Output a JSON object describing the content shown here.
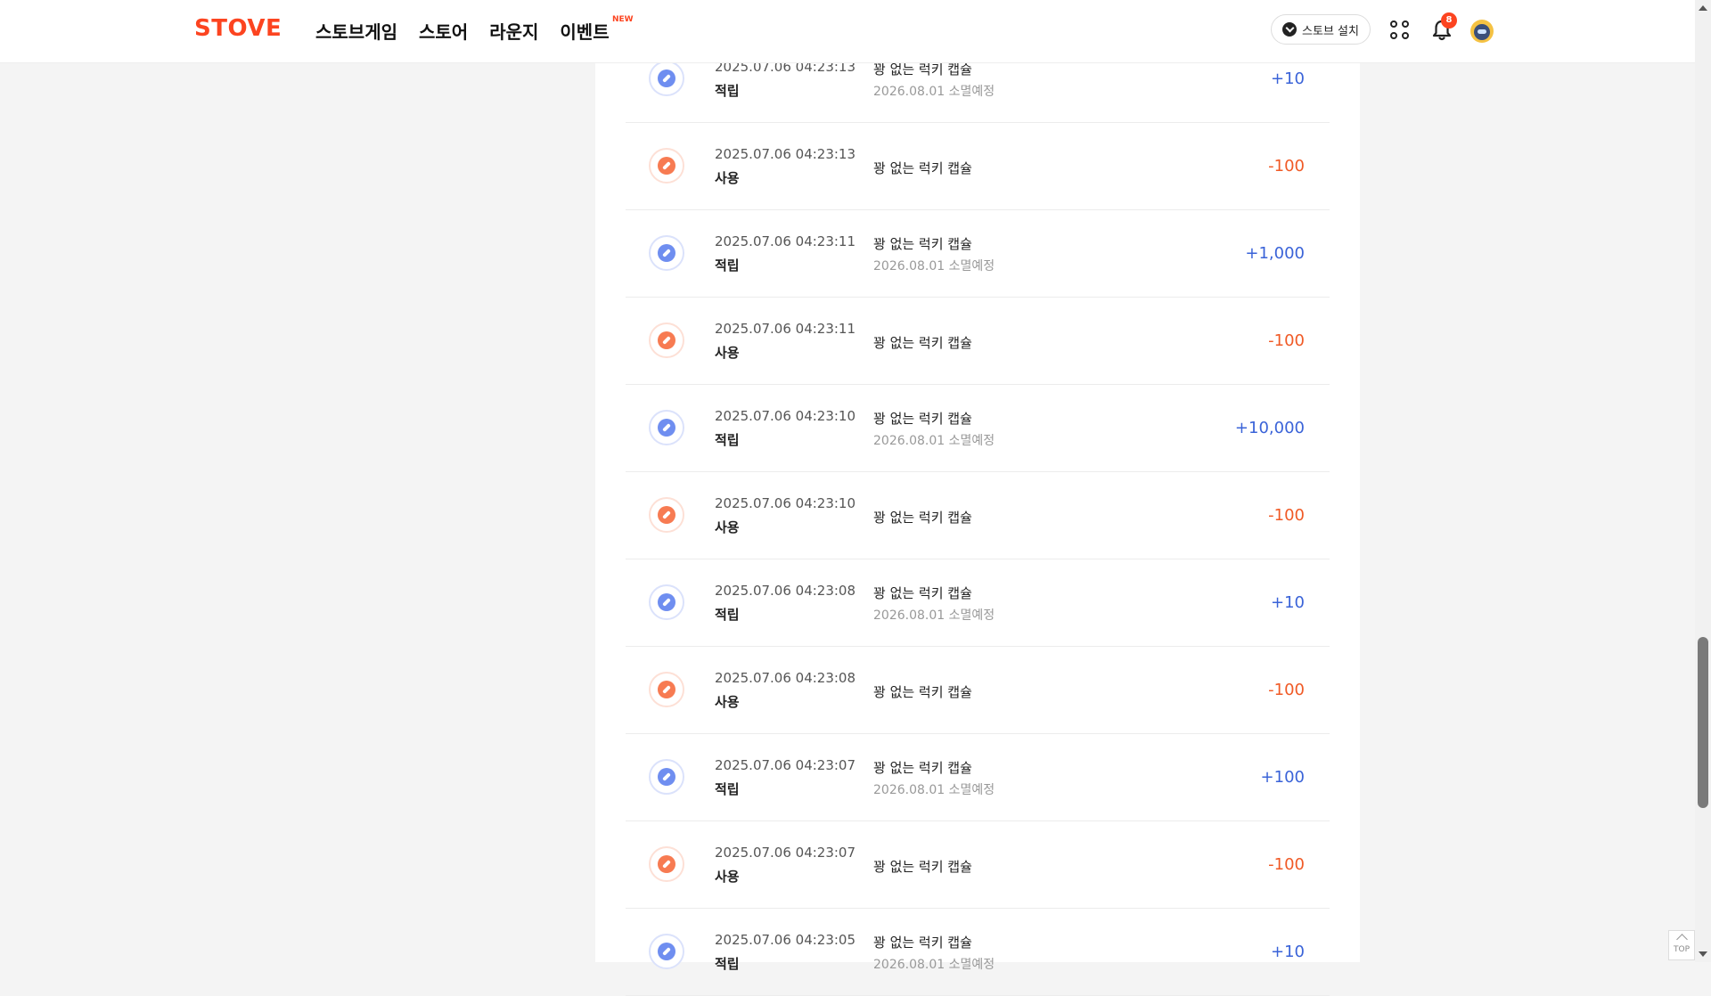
{
  "header": {
    "logo": "STOVE",
    "nav": [
      {
        "label": "스토브게임"
      },
      {
        "label": "스토어"
      },
      {
        "label": "라운지"
      },
      {
        "label": "이벤트",
        "badge": "NEW"
      }
    ],
    "install_label": "스토브 설치",
    "notification_count": "8"
  },
  "colors": {
    "brand": "#fc4420",
    "earn": "#3a63d8",
    "use": "#f05a26"
  },
  "history": [
    {
      "date": "2025.07.06 04:23:13",
      "type": "적립",
      "desc": "꽝 없는 럭키 캡슐",
      "expire": "2026.08.01 소멸예정",
      "amount": "+10",
      "kind": "earn"
    },
    {
      "date": "2025.07.06 04:23:13",
      "type": "사용",
      "desc": "꽝 없는 럭키 캡슐",
      "expire": "",
      "amount": "-100",
      "kind": "use"
    },
    {
      "date": "2025.07.06 04:23:11",
      "type": "적립",
      "desc": "꽝 없는 럭키 캡슐",
      "expire": "2026.08.01 소멸예정",
      "amount": "+1,000",
      "kind": "earn"
    },
    {
      "date": "2025.07.06 04:23:11",
      "type": "사용",
      "desc": "꽝 없는 럭키 캡슐",
      "expire": "",
      "amount": "-100",
      "kind": "use"
    },
    {
      "date": "2025.07.06 04:23:10",
      "type": "적립",
      "desc": "꽝 없는 럭키 캡슐",
      "expire": "2026.08.01 소멸예정",
      "amount": "+10,000",
      "kind": "earn"
    },
    {
      "date": "2025.07.06 04:23:10",
      "type": "사용",
      "desc": "꽝 없는 럭키 캡슐",
      "expire": "",
      "amount": "-100",
      "kind": "use"
    },
    {
      "date": "2025.07.06 04:23:08",
      "type": "적립",
      "desc": "꽝 없는 럭키 캡슐",
      "expire": "2026.08.01 소멸예정",
      "amount": "+10",
      "kind": "earn"
    },
    {
      "date": "2025.07.06 04:23:08",
      "type": "사용",
      "desc": "꽝 없는 럭키 캡슐",
      "expire": "",
      "amount": "-100",
      "kind": "use"
    },
    {
      "date": "2025.07.06 04:23:07",
      "type": "적립",
      "desc": "꽝 없는 럭키 캡슐",
      "expire": "2026.08.01 소멸예정",
      "amount": "+100",
      "kind": "earn"
    },
    {
      "date": "2025.07.06 04:23:07",
      "type": "사용",
      "desc": "꽝 없는 럭키 캡슐",
      "expire": "",
      "amount": "-100",
      "kind": "use"
    },
    {
      "date": "2025.07.06 04:23:05",
      "type": "적립",
      "desc": "꽝 없는 럭키 캡슐",
      "expire": "2026.08.01 소멸예정",
      "amount": "+10",
      "kind": "earn"
    }
  ],
  "top_button_label": "TOP"
}
